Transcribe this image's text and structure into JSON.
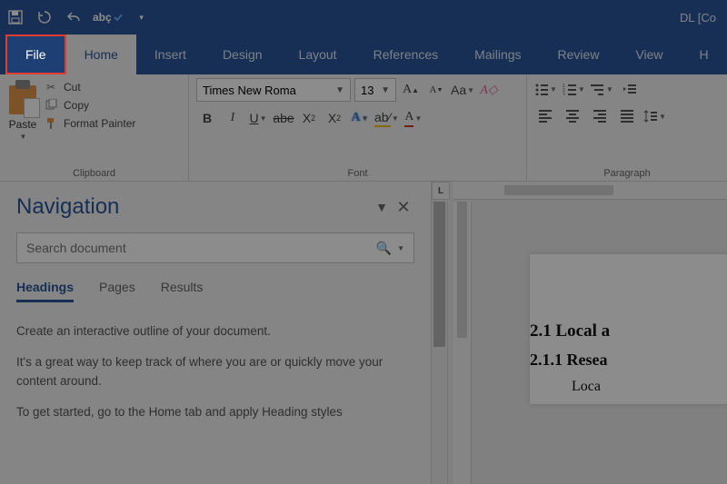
{
  "titlebar": {
    "doc_title": "DL [Co"
  },
  "tabs": [
    "File",
    "Home",
    "Insert",
    "Design",
    "Layout",
    "References",
    "Mailings",
    "Review",
    "View",
    "H"
  ],
  "ribbon": {
    "clipboard": {
      "label": "Clipboard",
      "paste": "Paste",
      "cut": "Cut",
      "copy": "Copy",
      "format_painter": "Format Painter"
    },
    "font": {
      "label": "Font",
      "name": "Times New Roma",
      "size": "13"
    },
    "paragraph": {
      "label": "Paragraph"
    }
  },
  "navigation": {
    "title": "Navigation",
    "search_placeholder": "Search document",
    "tabs": [
      "Headings",
      "Pages",
      "Results"
    ],
    "paras": [
      "Create an interactive outline of your document.",
      "It's a great way to keep track of where you are or quickly move your content around.",
      "To get started, go to the Home tab and apply Heading styles"
    ]
  },
  "document": {
    "lines": [
      {
        "cls": "h2",
        "text": "2.1 Local a"
      },
      {
        "cls": "h3",
        "text": "2.1.1 Resea"
      },
      {
        "cls": "body-ln",
        "text": "Loca"
      }
    ]
  }
}
